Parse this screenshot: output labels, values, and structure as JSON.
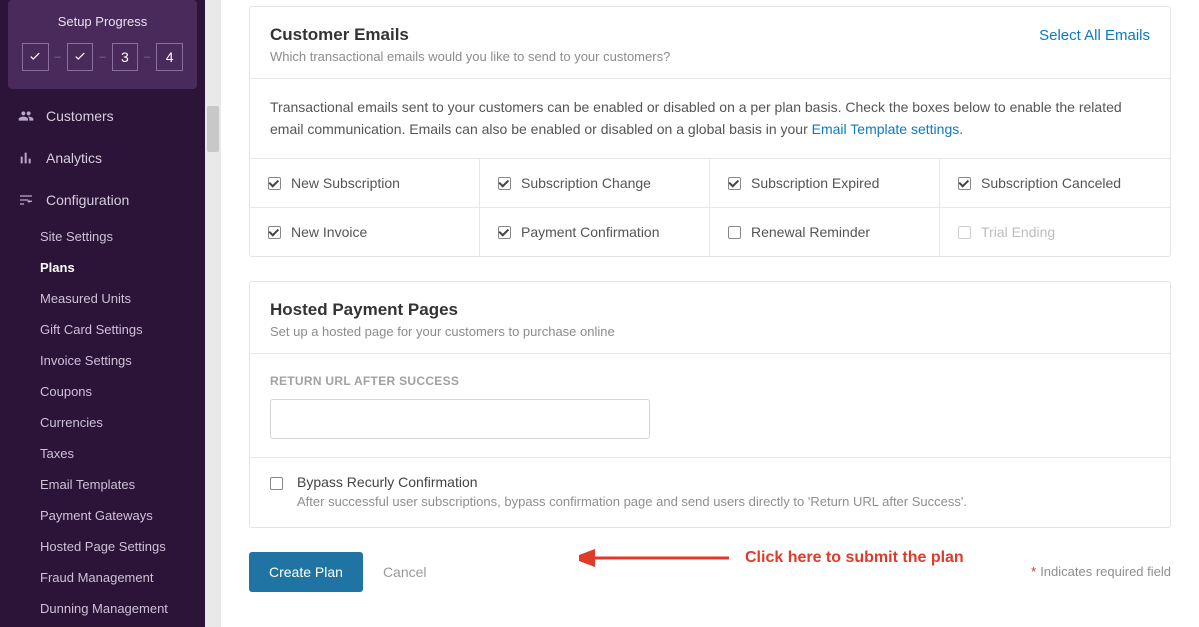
{
  "sidebar": {
    "setup_title": "Setup Progress",
    "steps": [
      "check",
      "check",
      "3",
      "4"
    ],
    "nav": [
      {
        "icon": "users",
        "label": "Customers"
      },
      {
        "icon": "analytics",
        "label": "Analytics"
      },
      {
        "icon": "config",
        "label": "Configuration"
      }
    ],
    "subnav": [
      {
        "label": "Site Settings",
        "active": false
      },
      {
        "label": "Plans",
        "active": true
      },
      {
        "label": "Measured Units",
        "active": false
      },
      {
        "label": "Gift Card Settings",
        "active": false
      },
      {
        "label": "Invoice Settings",
        "active": false
      },
      {
        "label": "Coupons",
        "active": false
      },
      {
        "label": "Currencies",
        "active": false
      },
      {
        "label": "Taxes",
        "active": false
      },
      {
        "label": "Email Templates",
        "active": false
      },
      {
        "label": "Payment Gateways",
        "active": false
      },
      {
        "label": "Hosted Page Settings",
        "active": false
      },
      {
        "label": "Fraud Management",
        "active": false
      },
      {
        "label": "Dunning Management",
        "active": false
      }
    ]
  },
  "emails_section": {
    "title": "Customer Emails",
    "subtitle": "Which transactional emails would you like to send to your customers?",
    "select_all": "Select All Emails",
    "description_prefix": "Transactional emails sent to your customers can be enabled or disabled on a per plan basis. Check the boxes below to enable the related email communication. Emails can also be enabled or disabled on a global basis in your ",
    "description_link": "Email Template settings",
    "description_suffix": ".",
    "items": [
      {
        "label": "New Subscription",
        "checked": true,
        "disabled": false
      },
      {
        "label": "Subscription Change",
        "checked": true,
        "disabled": false
      },
      {
        "label": "Subscription Expired",
        "checked": true,
        "disabled": false
      },
      {
        "label": "Subscription Canceled",
        "checked": true,
        "disabled": false
      },
      {
        "label": "New Invoice",
        "checked": true,
        "disabled": false
      },
      {
        "label": "Payment Confirmation",
        "checked": true,
        "disabled": false
      },
      {
        "label": "Renewal Reminder",
        "checked": false,
        "disabled": false
      },
      {
        "label": "Trial Ending",
        "checked": false,
        "disabled": true
      }
    ]
  },
  "hosted_section": {
    "title": "Hosted Payment Pages",
    "subtitle": "Set up a hosted page for your customers to purchase online",
    "field_label": "RETURN URL AFTER SUCCESS",
    "field_value": "",
    "bypass_label": "Bypass Recurly Confirmation",
    "bypass_hint": "After successful user subscriptions, bypass confirmation page and send users directly to 'Return URL after Success'.",
    "bypass_checked": false
  },
  "actions": {
    "primary": "Create Plan",
    "cancel": "Cancel",
    "required_note": "Indicates required field"
  },
  "annotation": {
    "text": "Click here to submit the plan"
  }
}
